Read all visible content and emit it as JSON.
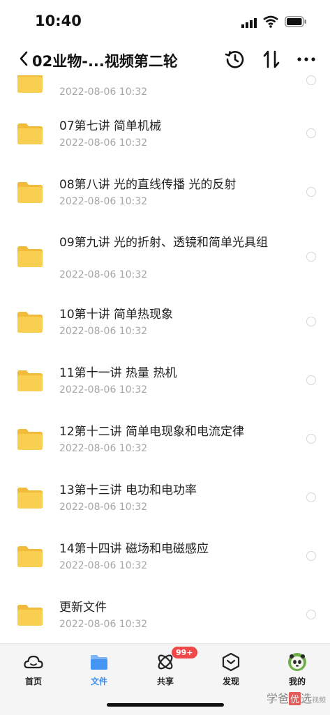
{
  "status": {
    "time": "10:40"
  },
  "nav": {
    "title": "02业物-...视频第二轮"
  },
  "files": [
    {
      "name": "",
      "date": "2022-08-06 10:32"
    },
    {
      "name": "07第七讲 简单机械",
      "date": "2022-08-06 10:32"
    },
    {
      "name": "08第八讲 光的直线传播 光的反射",
      "date": "2022-08-06 10:32"
    },
    {
      "name": "09第九讲 光的折射、透镜和简单光具组",
      "date": "2022-08-06 10:32"
    },
    {
      "name": "10第十讲 简单热现象",
      "date": "2022-08-06 10:32"
    },
    {
      "name": "11第十一讲 热量 热机",
      "date": "2022-08-06 10:32"
    },
    {
      "name": "12第十二讲 简单电现象和电流定律",
      "date": "2022-08-06 10:32"
    },
    {
      "name": "13第十三讲 电功和电功率",
      "date": "2022-08-06 10:32"
    },
    {
      "name": "14第十四讲 磁场和电磁感应",
      "date": "2022-08-06 10:32"
    },
    {
      "name": "更新文件",
      "date": "2022-08-06 10:32"
    }
  ],
  "tabs": [
    {
      "label": "首页",
      "icon": "cloud-icon"
    },
    {
      "label": "文件",
      "icon": "folder-icon",
      "active": true
    },
    {
      "label": "共享",
      "icon": "share-icon",
      "badge": "99+"
    },
    {
      "label": "发现",
      "icon": "discover-icon"
    },
    {
      "label": "我的",
      "icon": "avatar-icon"
    }
  ],
  "watermark": {
    "text1": "学爸",
    "text2": "优",
    "text3": "选",
    "small": "视频"
  },
  "colors": {
    "accent": "#3b8af0",
    "folder": "#f7c948",
    "badge": "#f04848"
  }
}
